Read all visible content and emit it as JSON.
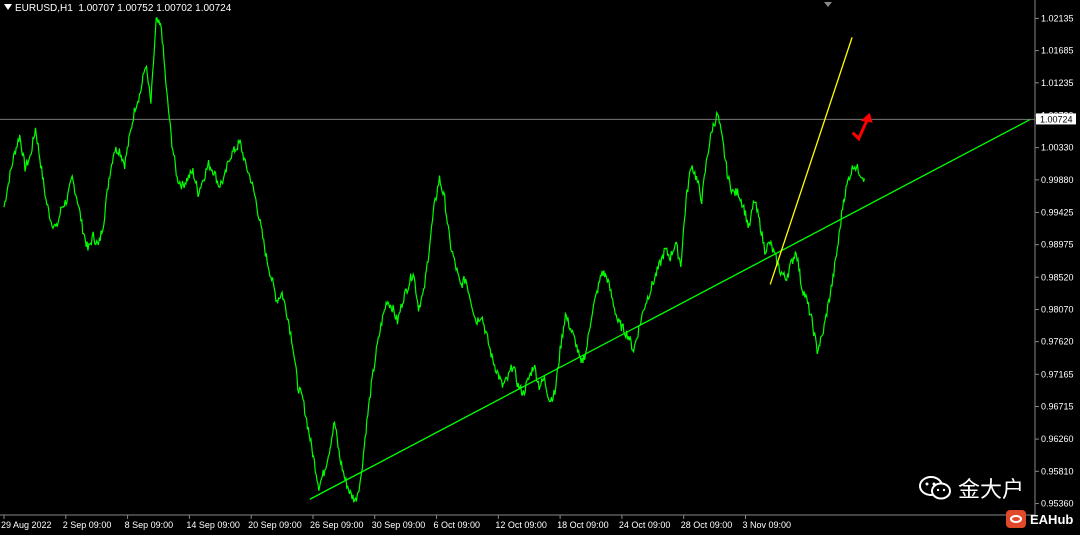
{
  "header": {
    "symbol": "EURUSD,H1",
    "ohlc": "1.00707 1.00752 1.00702 1.00724"
  },
  "watermark": {
    "text": "金大户",
    "icon": "wechat-icon",
    "brand": "EAHub",
    "brand_icon": "eahub-logo-icon"
  },
  "colors": {
    "background": "#000000",
    "price_line": "#00ff00",
    "trendline_green": "#00ff00",
    "trendline_yellow": "#ffff00",
    "arrow": "#ff0000",
    "axis_text": "#ffffff"
  },
  "chart_data": {
    "type": "line",
    "title": "EURUSD,H1",
    "grid": false,
    "current_price": 1.00724,
    "current_price_label": "1.00724",
    "ylim": [
      0.9527,
      1.0228
    ],
    "y_ticks": [
      "1.02135",
      "1.01685",
      "1.01235",
      "1.00780",
      "1.00330",
      "0.99880",
      "0.99425",
      "0.98975",
      "0.98520",
      "0.98070",
      "0.97620",
      "0.97165",
      "0.96715",
      "0.96260",
      "0.95810",
      "0.95360"
    ],
    "x_ticks": [
      "29 Aug 2022",
      "2 Sep 09:00",
      "8 Sep 09:00",
      "14 Sep 09:00",
      "20 Sep 09:00",
      "26 Sep 09:00",
      "30 Sep 09:00",
      "6 Oct 09:00",
      "12 Oct 09:00",
      "18 Oct 09:00",
      "24 Oct 09:00",
      "28 Oct 09:00",
      "3 Nov 09:00"
    ],
    "x_tick_index": [
      0,
      4,
      8,
      12,
      16,
      20,
      24,
      28,
      32,
      36,
      40,
      44,
      48
    ],
    "xlim": [
      0,
      67
    ],
    "series": [
      {
        "values": [
          0.995,
          0.999,
          1.0025,
          1.005,
          1.0005,
          1.002,
          1.006,
          1.001,
          0.996,
          0.993,
          0.992,
          0.995,
          0.996,
          0.999,
          0.996,
          0.992,
          0.989,
          0.991,
          0.9895,
          0.993,
          0.999,
          1.003,
          1.003,
          1.001,
          1.005,
          1.009,
          1.011,
          1.015,
          1.0095,
          1.021,
          1.02,
          1.011,
          1.004,
          0.999,
          0.998,
          0.999,
          1.0,
          0.997,
          0.999,
          1.001,
          1.0,
          0.998,
          0.999,
          1.002,
          1.003,
          1.004,
          1.001,
          0.999,
          0.996,
          0.992,
          0.988,
          0.985,
          0.982,
          0.983,
          0.98,
          0.976,
          0.97,
          0.968,
          0.964,
          0.96,
          0.956,
          0.958,
          0.961,
          0.965,
          0.96,
          0.957,
          0.955,
          0.954,
          0.957,
          0.964,
          0.97,
          0.975,
          0.979,
          0.982,
          0.981,
          0.979,
          0.982,
          0.984,
          0.986,
          0.981,
          0.983,
          0.989,
          0.995,
          0.999,
          0.996,
          0.99,
          0.987,
          0.984,
          0.985,
          0.982,
          0.979,
          0.98,
          0.977,
          0.974,
          0.972,
          0.97,
          0.971,
          0.973,
          0.97,
          0.969,
          0.971,
          0.973,
          0.97,
          0.971,
          0.968,
          0.969,
          0.975,
          0.98,
          0.978,
          0.976,
          0.973,
          0.975,
          0.98,
          0.983,
          0.986,
          0.985,
          0.982,
          0.979,
          0.978,
          0.977,
          0.975,
          0.978,
          0.981,
          0.983,
          0.985,
          0.987,
          0.989,
          0.988,
          0.99,
          0.987,
          0.996,
          1.001,
          0.999,
          0.996,
          1.002,
          1.006,
          1.008,
          1.004,
          0.999,
          0.997,
          0.997,
          0.995,
          0.992,
          0.996,
          0.993,
          0.989,
          0.99,
          0.988,
          0.986,
          0.985,
          0.987,
          0.989,
          0.984,
          0.982,
          0.979,
          0.975,
          0.977,
          0.981,
          0.985,
          0.99,
          0.996,
          0.999,
          1.001,
          1.0,
          0.999
        ]
      }
    ],
    "trendlines": [
      {
        "color": "#00ff00",
        "start": [
          19.8,
          0.9542
        ],
        "end": [
          66.4,
          1.0072
        ]
      },
      {
        "color": "#ffff00",
        "start": [
          49.6,
          0.9842
        ],
        "end": [
          54.9,
          1.0187
        ]
      }
    ],
    "arrow": {
      "color": "#ff0000",
      "direction": "up",
      "at": [
        55.2,
        1.0065
      ]
    }
  }
}
